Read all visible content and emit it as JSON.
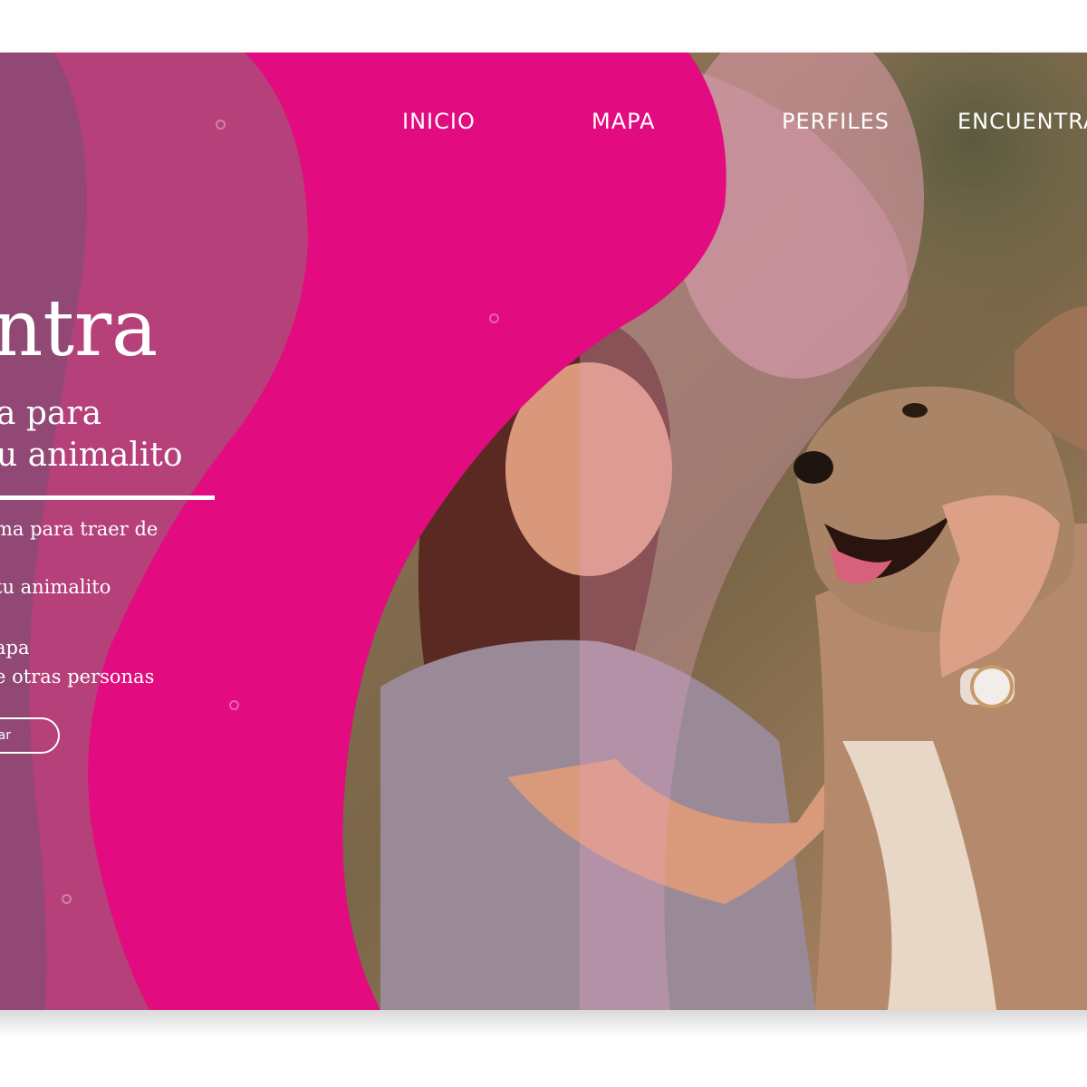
{
  "nav": {
    "items": [
      {
        "label": "INICIO"
      },
      {
        "label": "MAPA"
      },
      {
        "label": "PERFILES"
      },
      {
        "label": "ENCUENTRA"
      }
    ]
  },
  "hero": {
    "title": "ntra",
    "subtitle_line1": "a para",
    "subtitle_line2": "u animalito"
  },
  "features": {
    "line1": "ma para traer de",
    "line2": "tu animalito",
    "line3": "apa",
    "line4": "e otras personas"
  },
  "cta": {
    "label": "ar"
  },
  "colors": {
    "magenta": "#e20b7f",
    "mauve": "#b5407a",
    "plum": "#8b4a73"
  },
  "photo": {
    "subject": "woman-hugging-dog-photo"
  }
}
